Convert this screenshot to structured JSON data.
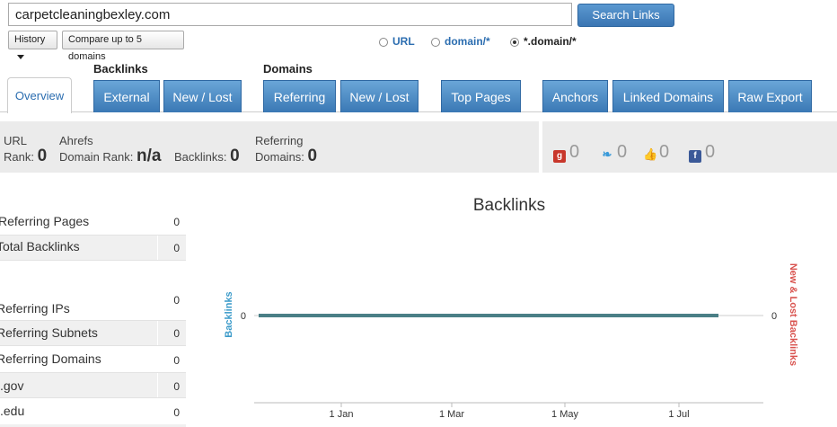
{
  "search": {
    "value": "carpetcleaningbexley.com",
    "button_label": "Search Links",
    "history_label": "History",
    "compare_label": "Compare up to 5 domains"
  },
  "scope": {
    "options": [
      "URL",
      "domain/*",
      "*.domain/*"
    ],
    "selected": "*.domain/*"
  },
  "nav": {
    "overview": "Overview",
    "backlinks_label": "Backlinks",
    "domains_label": "Domains",
    "external": "External",
    "backlinks_new_lost": "New / Lost",
    "referring": "Referring",
    "domains_new_lost": "New / Lost",
    "top_pages": "Top Pages",
    "anchors": "Anchors",
    "linked_domains": "Linked Domains",
    "raw_export": "Raw Export"
  },
  "stats": {
    "url_rank_label_1": "URL",
    "url_rank_label_2": "Rank:",
    "url_rank_value": "0",
    "domain_rank_label_1": "Ahrefs",
    "domain_rank_label_2": "Domain Rank:",
    "domain_rank_value": "n/a",
    "backlinks_label": "Backlinks:",
    "backlinks_value": "0",
    "ref_domains_label_1": "Referring",
    "ref_domains_label_2": "Domains:",
    "ref_domains_value": "0"
  },
  "social": {
    "googleplus": "0",
    "twitter": "0",
    "likes": "0",
    "facebook": "0"
  },
  "metrics": [
    {
      "label": "Referring Pages",
      "value": "0"
    },
    {
      "label": "Total Backlinks",
      "value": "0"
    },
    {
      "label": "Referring IPs",
      "value": "0"
    },
    {
      "label": "Referring Subnets",
      "value": "0"
    },
    {
      "label": "Referring Domains",
      "value": "0"
    },
    {
      "label": ".gov",
      "value": "0"
    },
    {
      "label": ".edu",
      "value": "0"
    }
  ],
  "chart_data": {
    "type": "line",
    "title": "Backlinks",
    "ylabel": "Backlinks",
    "y2label": "New & Lost Backlinks",
    "x_ticks": [
      "1 Jan",
      "1 Mar",
      "1 May",
      "1 Jul"
    ],
    "y_ticks": [
      "0"
    ],
    "y2_ticks": [
      "0"
    ],
    "series": [
      {
        "name": "Backlinks",
        "values": [
          0,
          0
        ],
        "color": "#4a7f86"
      }
    ]
  }
}
